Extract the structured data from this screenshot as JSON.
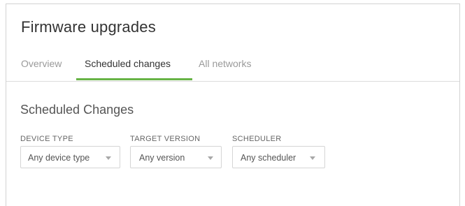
{
  "header": {
    "title": "Firmware upgrades"
  },
  "tabs": [
    {
      "label": "Overview",
      "active": false
    },
    {
      "label": "Scheduled changes",
      "active": true
    },
    {
      "label": "All networks",
      "active": false
    }
  ],
  "section": {
    "title": "Scheduled Changes"
  },
  "filters": [
    {
      "label": "DEVICE TYPE",
      "value": "Any device type",
      "icon": "chevron-down-icon"
    },
    {
      "label": "TARGET VERSION",
      "value": "Any version",
      "icon": "chevron-down-icon"
    },
    {
      "label": "SCHEDULER",
      "value": "Any scheduler",
      "icon": "chevron-down-icon"
    }
  ],
  "colors": {
    "accent": "#67b346",
    "active_tab_text": "#333333",
    "inactive_tab_text": "#9a9a9a"
  }
}
